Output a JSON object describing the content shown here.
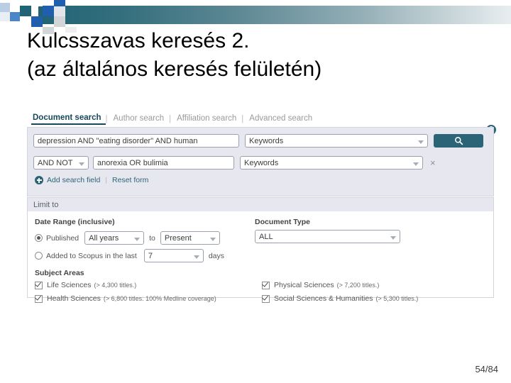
{
  "slide": {
    "title_line1": "Kulcsszavas keresés 2.",
    "title_line2": "(az általános keresés felületén)",
    "page_number": "54/84"
  },
  "scopus": {
    "tabs": [
      {
        "label": "Document search",
        "active": true
      },
      {
        "label": "Author search",
        "active": false
      },
      {
        "label": "Affiliation search",
        "active": false
      },
      {
        "label": "Advanced search",
        "active": false
      }
    ],
    "tab_separator": "|",
    "help_icon_label": "?",
    "search_rows": [
      {
        "operator": null,
        "query": "depression AND \"eating disorder\" AND human",
        "field": "Keywords"
      },
      {
        "operator": "AND NOT",
        "query": "anorexia OR bulimia",
        "field": "Keywords"
      }
    ],
    "search_button_icon": "search-icon",
    "remove_row_icon": "×",
    "add_search_field_label": "Add search field",
    "link_separator": "|",
    "reset_form_label": "Reset form",
    "limit_to_label": "Limit to",
    "date_range": {
      "heading": "Date Range (inclusive)",
      "published_label": "Published",
      "published_selected": true,
      "from_value": "All years",
      "to_label": "to",
      "to_value": "Present",
      "added_label": "Added to Scopus in the last",
      "added_selected": false,
      "added_value": "7",
      "days_label": "days"
    },
    "document_type": {
      "heading": "Document Type",
      "value": "ALL"
    },
    "subject_areas": {
      "heading": "Subject Areas",
      "items": [
        {
          "label": "Life Sciences",
          "detail": "(> 4,300 titles.)",
          "checked": true
        },
        {
          "label": "Health Sciences",
          "detail": "(> 6,800 titles. 100% Medline coverage)",
          "checked": true
        },
        {
          "label": "Physical Sciences",
          "detail": "(> 7,200 titles.)",
          "checked": true
        },
        {
          "label": "Social Sciences & Humanities",
          "detail": "(> 5,300 titles.)",
          "checked": true
        }
      ]
    }
  },
  "colors": {
    "accent_teal": "#2c6477",
    "panel_bg": "#e7e8ef",
    "deco_blue": "#1f5fae",
    "deco_teal": "#1f6374"
  }
}
